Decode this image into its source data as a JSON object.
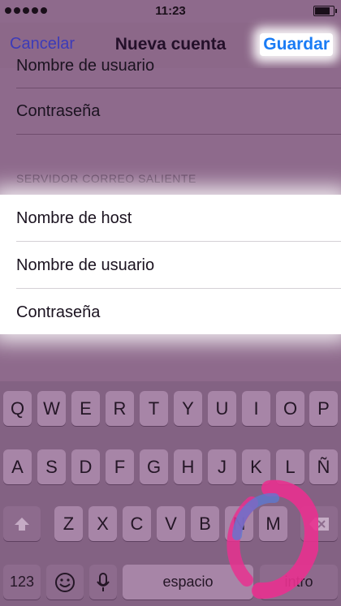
{
  "status_bar": {
    "time": "11:23",
    "battery_level": 0.9
  },
  "nav": {
    "cancel_label": "Cancelar",
    "title": "Nueva cuenta",
    "save_label": "Guardar"
  },
  "incoming": {
    "partial_row": "Nombre de usuario",
    "password": "Contraseña"
  },
  "outgoing": {
    "header": "SERVIDOR CORREO SALIENTE",
    "hostname": "Nombre de host",
    "username": "Nombre de usuario",
    "password": "Contraseña"
  },
  "keyboard": {
    "row1": [
      "Q",
      "W",
      "E",
      "R",
      "T",
      "Y",
      "U",
      "I",
      "O",
      "P"
    ],
    "row2": [
      "A",
      "S",
      "D",
      "F",
      "G",
      "H",
      "J",
      "K",
      "L",
      "Ñ"
    ],
    "row3": [
      "Z",
      "X",
      "C",
      "V",
      "B",
      "N",
      "M"
    ],
    "numbers_label": "123",
    "space_label": "espacio",
    "return_label": "intro"
  },
  "icons": {
    "shift": "shift-icon",
    "delete": "delete-icon",
    "emoji": "emoji-icon",
    "mic": "microphone-icon"
  },
  "colors": {
    "accent": "#1a7cf5",
    "overlay": "#8e6a8c",
    "keyboard": "#836283"
  }
}
